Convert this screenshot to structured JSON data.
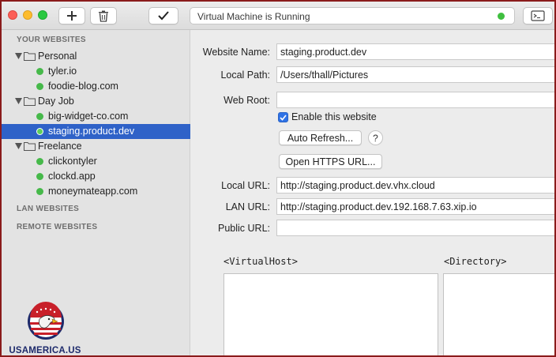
{
  "toolbar": {
    "status_text": "Virtual Machine is Running",
    "status_color": "#3fbf3f",
    "add_icon": "plus-icon",
    "delete_icon": "trash-icon",
    "apply_icon": "checkmark-icon",
    "terminal_icon": "terminal-icon"
  },
  "sidebar": {
    "your_websites_heading": "YOUR WEBSITES",
    "groups": [
      {
        "name": "Personal",
        "sites": [
          "tyler.io",
          "foodie-blog.com"
        ]
      },
      {
        "name": "Day Job",
        "sites": [
          "big-widget-co.com",
          "staging.product.dev"
        ]
      },
      {
        "name": "Freelance",
        "sites": [
          "clickontyler",
          "clockd.app",
          "moneymateapp.com"
        ]
      }
    ],
    "selected_site": "staging.product.dev",
    "lan_heading": "LAN WEBSITES",
    "remote_heading": "REMOTE WEBSITES"
  },
  "form": {
    "website_name_label": "Website Name:",
    "website_name_value": "staging.product.dev",
    "local_path_label": "Local Path:",
    "local_path_value": "/Users/thall/Pictures",
    "web_root_label": "Web Root:",
    "web_root_value": "",
    "enable_label": "Enable this website",
    "auto_refresh_label": "Auto Refresh...",
    "help_label": "?",
    "open_https_label": "Open HTTPS URL...",
    "local_url_label": "Local URL:",
    "local_url_value": "http://staging.product.dev.vhx.cloud",
    "lan_url_label": "LAN URL:",
    "lan_url_value": "http://staging.product.dev.192.168.7.63.xip.io",
    "public_url_label": "Public URL:",
    "public_url_value": "",
    "virtualhost_label": "<VirtualHost>",
    "directory_label": "<Directory>"
  },
  "watermark": {
    "text": "USAMERICA.US"
  },
  "colors": {
    "selection": "#2f62c8",
    "site_dot": "#46b94a",
    "frame_border": "#8a1b1b"
  }
}
